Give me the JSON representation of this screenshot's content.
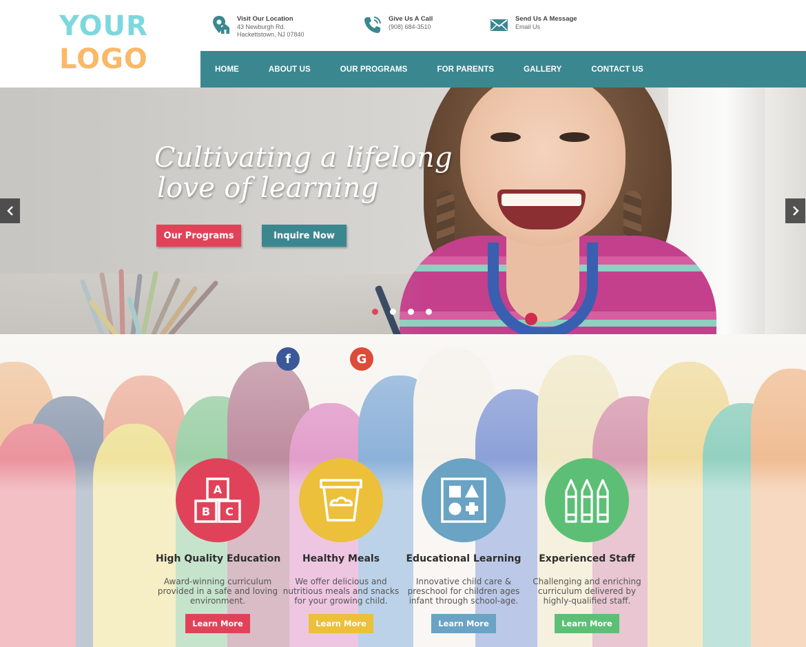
{
  "logo": {
    "line1": "YOUR",
    "line2": "LOGO"
  },
  "contacts": [
    {
      "icon": "location-icon",
      "title": "Visit Our Location",
      "line1": "43 Newburgh Rd.",
      "line2": "Hackettstown, NJ 07840"
    },
    {
      "icon": "phone-icon",
      "title": "Give Us A Call",
      "line1": "(908) 684-3510",
      "line2": ""
    },
    {
      "icon": "envelope-icon",
      "title": "Send Us A Message",
      "line1": "Email Us",
      "line2": ""
    }
  ],
  "nav": [
    "HOME",
    "ABOUT US",
    "OUR PROGRAMS",
    "FOR PARENTS",
    "GALLERY",
    "CONTACT US"
  ],
  "hero": {
    "title_line1": "Cultivating a lifelong",
    "title_line2": "love of learning",
    "btn_programs": "Our Programs",
    "btn_inquire": "Inquire Now",
    "slides": 4,
    "active_slide": 1
  },
  "social": {
    "facebook": "f",
    "google": "G"
  },
  "features": [
    {
      "icon": "abc-blocks-icon",
      "title": "High Quality Education",
      "text": "Award-winning curriculum provided in a safe and loving environment.",
      "button": "Learn More",
      "color": "#e04359"
    },
    {
      "icon": "food-cup-icon",
      "title": "Healthy Meals",
      "text": "We offer delicious and nutritious meals and snacks for your growing child.",
      "button": "Learn More",
      "color": "#ecc03b"
    },
    {
      "icon": "shape-sorter-icon",
      "title": "Educational Learning",
      "text": "Innovative child care & preschool for children ages infant through school-age.",
      "button": "Learn More",
      "color": "#6aa3c4"
    },
    {
      "icon": "crayons-icon",
      "title": "Experienced Staff",
      "text": "Challenging and enriching curriculum delivered by highly-qualified staff.",
      "button": "Learn More",
      "color": "#5dbf76"
    }
  ],
  "colors": {
    "teal": "#3b8790",
    "red": "#e04359",
    "logo_blue": "#7dd8dd",
    "logo_orange": "#f9b968"
  }
}
